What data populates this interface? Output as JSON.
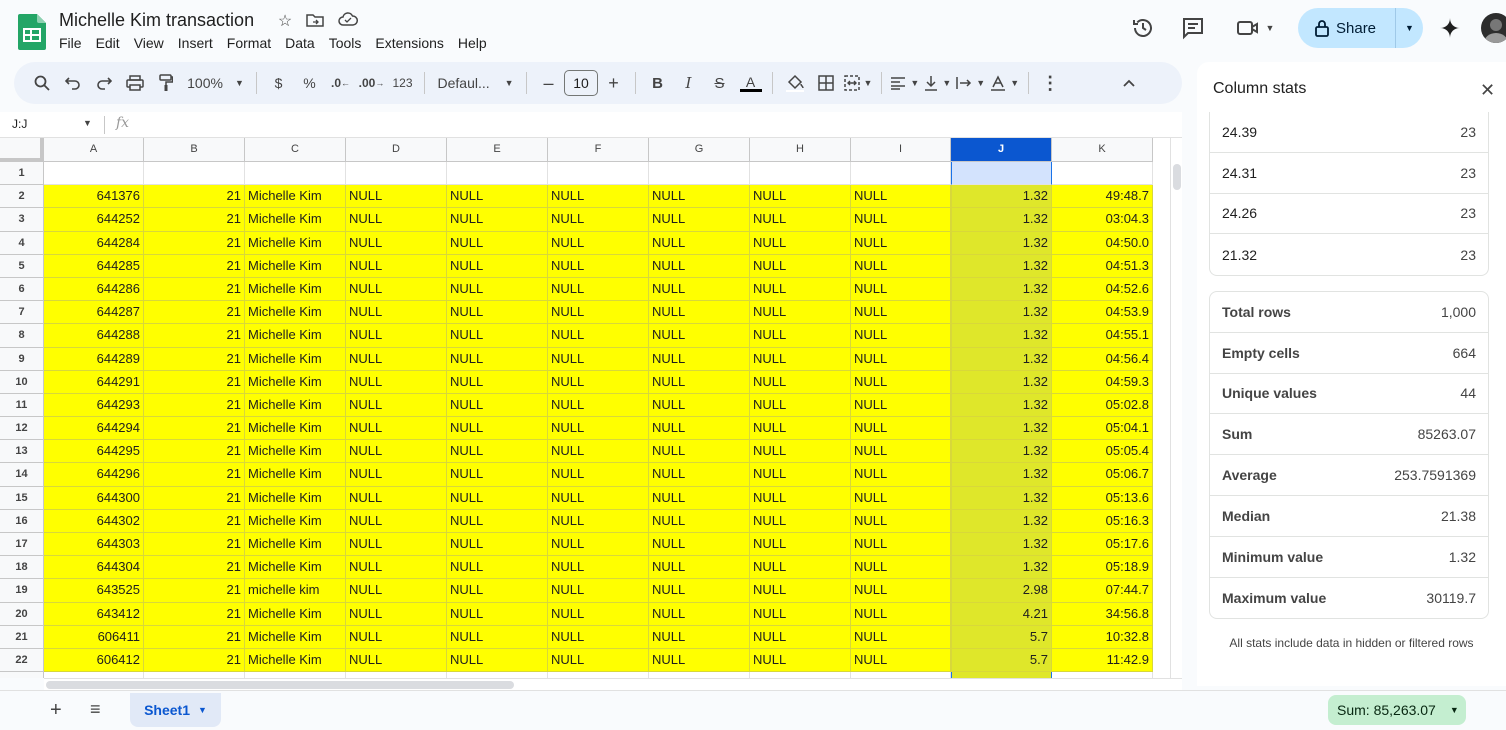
{
  "doc": {
    "title": "Michelle Kim transaction",
    "menu": [
      "File",
      "Edit",
      "View",
      "Insert",
      "Format",
      "Data",
      "Tools",
      "Extensions",
      "Help"
    ],
    "share_label": "Share"
  },
  "toolbar": {
    "zoom": "100%",
    "currency": "$",
    "percent": "%",
    "dec_decrease": ".0",
    "dec_increase": ".00",
    "format_123": "123",
    "font": "Defaul...",
    "font_size": "10",
    "bold": "B",
    "italic": "I",
    "strike": "S",
    "text_color": "A",
    "text_color_swatch": "#000000"
  },
  "formula_bar": {
    "name_box": "J:J",
    "fx": "fx"
  },
  "grid": {
    "columns": [
      "A",
      "B",
      "C",
      "D",
      "E",
      "F",
      "G",
      "H",
      "I",
      "J",
      "K"
    ],
    "selected_column": "J",
    "highlight_color": "#ffff00",
    "rows": [
      {
        "n": "1",
        "cells": [
          "",
          "",
          "",
          "",
          "",
          "",
          "",
          "",
          "",
          "",
          ""
        ]
      },
      {
        "n": "2",
        "cells": [
          "641376",
          "21",
          "Michelle Kim",
          "NULL",
          "NULL",
          "NULL",
          "NULL",
          "NULL",
          "NULL",
          "1.32",
          "49:48.7"
        ]
      },
      {
        "n": "3",
        "cells": [
          "644252",
          "21",
          "Michelle Kim",
          "NULL",
          "NULL",
          "NULL",
          "NULL",
          "NULL",
          "NULL",
          "1.32",
          "03:04.3"
        ]
      },
      {
        "n": "4",
        "cells": [
          "644284",
          "21",
          "Michelle Kim",
          "NULL",
          "NULL",
          "NULL",
          "NULL",
          "NULL",
          "NULL",
          "1.32",
          "04:50.0"
        ]
      },
      {
        "n": "5",
        "cells": [
          "644285",
          "21",
          "Michelle Kim",
          "NULL",
          "NULL",
          "NULL",
          "NULL",
          "NULL",
          "NULL",
          "1.32",
          "04:51.3"
        ]
      },
      {
        "n": "6",
        "cells": [
          "644286",
          "21",
          "Michelle Kim",
          "NULL",
          "NULL",
          "NULL",
          "NULL",
          "NULL",
          "NULL",
          "1.32",
          "04:52.6"
        ]
      },
      {
        "n": "7",
        "cells": [
          "644287",
          "21",
          "Michelle Kim",
          "NULL",
          "NULL",
          "NULL",
          "NULL",
          "NULL",
          "NULL",
          "1.32",
          "04:53.9"
        ]
      },
      {
        "n": "8",
        "cells": [
          "644288",
          "21",
          "Michelle Kim",
          "NULL",
          "NULL",
          "NULL",
          "NULL",
          "NULL",
          "NULL",
          "1.32",
          "04:55.1"
        ]
      },
      {
        "n": "9",
        "cells": [
          "644289",
          "21",
          "Michelle Kim",
          "NULL",
          "NULL",
          "NULL",
          "NULL",
          "NULL",
          "NULL",
          "1.32",
          "04:56.4"
        ]
      },
      {
        "n": "10",
        "cells": [
          "644291",
          "21",
          "Michelle Kim",
          "NULL",
          "NULL",
          "NULL",
          "NULL",
          "NULL",
          "NULL",
          "1.32",
          "04:59.3"
        ]
      },
      {
        "n": "11",
        "cells": [
          "644293",
          "21",
          "Michelle Kim",
          "NULL",
          "NULL",
          "NULL",
          "NULL",
          "NULL",
          "NULL",
          "1.32",
          "05:02.8"
        ]
      },
      {
        "n": "12",
        "cells": [
          "644294",
          "21",
          "Michelle Kim",
          "NULL",
          "NULL",
          "NULL",
          "NULL",
          "NULL",
          "NULL",
          "1.32",
          "05:04.1"
        ]
      },
      {
        "n": "13",
        "cells": [
          "644295",
          "21",
          "Michelle Kim",
          "NULL",
          "NULL",
          "NULL",
          "NULL",
          "NULL",
          "NULL",
          "1.32",
          "05:05.4"
        ]
      },
      {
        "n": "14",
        "cells": [
          "644296",
          "21",
          "Michelle Kim",
          "NULL",
          "NULL",
          "NULL",
          "NULL",
          "NULL",
          "NULL",
          "1.32",
          "05:06.7"
        ]
      },
      {
        "n": "15",
        "cells": [
          "644300",
          "21",
          "Michelle Kim",
          "NULL",
          "NULL",
          "NULL",
          "NULL",
          "NULL",
          "NULL",
          "1.32",
          "05:13.6"
        ]
      },
      {
        "n": "16",
        "cells": [
          "644302",
          "21",
          "Michelle Kim",
          "NULL",
          "NULL",
          "NULL",
          "NULL",
          "NULL",
          "NULL",
          "1.32",
          "05:16.3"
        ]
      },
      {
        "n": "17",
        "cells": [
          "644303",
          "21",
          "Michelle Kim",
          "NULL",
          "NULL",
          "NULL",
          "NULL",
          "NULL",
          "NULL",
          "1.32",
          "05:17.6"
        ]
      },
      {
        "n": "18",
        "cells": [
          "644304",
          "21",
          "Michelle Kim",
          "NULL",
          "NULL",
          "NULL",
          "NULL",
          "NULL",
          "NULL",
          "1.32",
          "05:18.9"
        ]
      },
      {
        "n": "19",
        "cells": [
          "643525",
          "21",
          "michelle kim",
          "NULL",
          "NULL",
          "NULL",
          "NULL",
          "NULL",
          "NULL",
          "2.98",
          "07:44.7"
        ]
      },
      {
        "n": "20",
        "cells": [
          "643412",
          "21",
          "Michelle Kim",
          "NULL",
          "NULL",
          "NULL",
          "NULL",
          "NULL",
          "NULL",
          "4.21",
          "34:56.8"
        ]
      },
      {
        "n": "21",
        "cells": [
          "606411",
          "21",
          "Michelle Kim",
          "NULL",
          "NULL",
          "NULL",
          "NULL",
          "NULL",
          "NULL",
          "5.7",
          "10:32.8"
        ]
      },
      {
        "n": "22",
        "cells": [
          "606412",
          "21",
          "Michelle Kim",
          "NULL",
          "NULL",
          "NULL",
          "NULL",
          "NULL",
          "NULL",
          "5.7",
          "11:42.9"
        ]
      },
      {
        "n": "23",
        "cells": [
          "",
          "",
          "",
          "",
          "",
          "",
          "",
          "",
          "",
          "",
          ""
        ]
      }
    ]
  },
  "sheets": {
    "active": "Sheet1"
  },
  "status": {
    "sum_chip": "Sum: 85,263.07"
  },
  "panel": {
    "title": "Column stats",
    "frequency": [
      {
        "value": "24.39",
        "count": "23"
      },
      {
        "value": "24.31",
        "count": "23"
      },
      {
        "value": "24.26",
        "count": "23"
      },
      {
        "value": "21.32",
        "count": "23"
      }
    ],
    "stats": [
      {
        "label": "Total rows",
        "value": "1,000"
      },
      {
        "label": "Empty cells",
        "value": "664"
      },
      {
        "label": "Unique values",
        "value": "44"
      },
      {
        "label": "Sum",
        "value": "85263.07"
      },
      {
        "label": "Average",
        "value": "253.7591369"
      },
      {
        "label": "Median",
        "value": "21.38"
      },
      {
        "label": "Minimum value",
        "value": "1.32"
      },
      {
        "label": "Maximum value",
        "value": "30119.7"
      }
    ],
    "note": "All stats include data in hidden or filtered rows"
  }
}
